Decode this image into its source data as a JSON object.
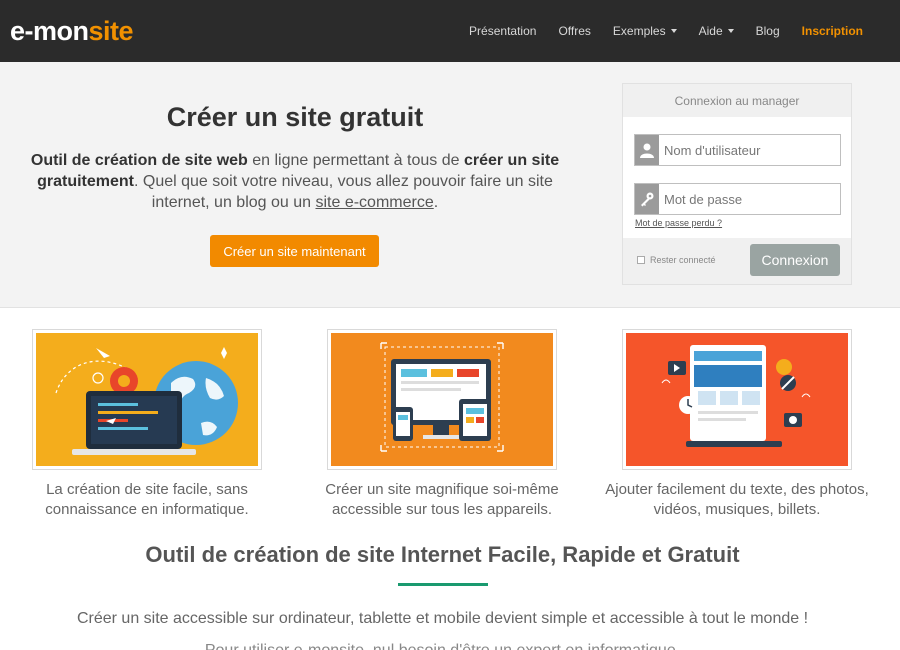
{
  "logo": {
    "part1": "e-mon",
    "part2": "site"
  },
  "nav": {
    "items": [
      {
        "label": "Présentation"
      },
      {
        "label": "Offres"
      },
      {
        "label": "Exemples"
      },
      {
        "label": "Aide"
      },
      {
        "label": "Blog"
      }
    ],
    "signup": "Inscription"
  },
  "hero": {
    "title": "Créer un site gratuit",
    "desc_bold1": "Outil de création de site web",
    "desc_text1": " en ligne permettant à tous de ",
    "desc_bold2": "créer un site gratuitement",
    "desc_text2": ". Quel que soit votre niveau, vous allez pouvoir faire un site internet, un blog ou un ",
    "desc_link": "site e-commerce",
    "desc_text3": ".",
    "cta": "Créer un site maintenant"
  },
  "login": {
    "title": "Connexion au manager",
    "username_placeholder": "Nom d'utilisateur",
    "password_placeholder": "Mot de passe",
    "forgot": "Mot de passe perdu ?",
    "remember": "Rester connecté",
    "submit": "Connexion"
  },
  "features": [
    {
      "caption": "La création de site facile, sans connaissance en informatique."
    },
    {
      "caption": "Créer un site magnifique soi-même accessible sur tous les appareils."
    },
    {
      "caption": "Ajouter facilement du texte, des photos, vidéos, musiques, billets."
    }
  ],
  "section": {
    "title": "Outil de création de site Internet Facile, Rapide et Gratuit",
    "line1": "Créer un site accessible sur ordinateur, tablette et mobile devient simple et accessible à tout le monde !",
    "line2": "Pour utiliser e-monsite, nul besoin d'être un expert en informatique."
  },
  "colors": {
    "brand_orange": "#f29100",
    "nav_bg": "#2b2b2b",
    "accent_green": "#1a9a6f",
    "feature1_bg": "#f4ad1c",
    "feature2_bg": "#f28a1e",
    "feature3_bg": "#f5552a"
  }
}
